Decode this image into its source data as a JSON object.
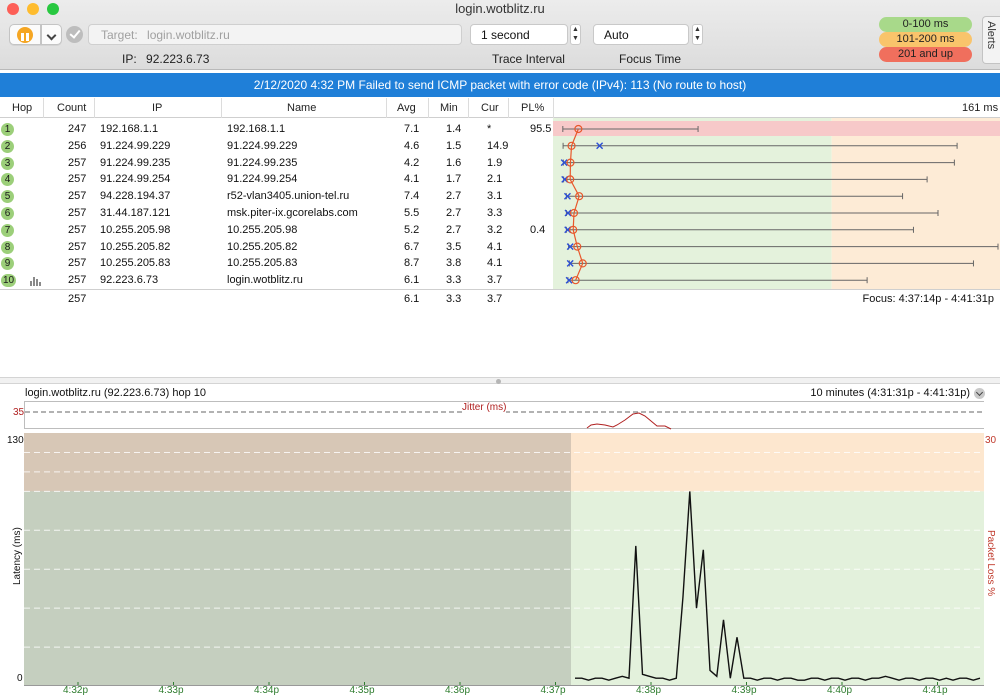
{
  "window": {
    "title": "login.wotblitz.ru"
  },
  "toolbar": {
    "target_label": "Target:",
    "target_value": "login.wotblitz.ru",
    "ip_label": "IP:",
    "ip_value": "92.223.6.73",
    "trace_interval_value": "1 second",
    "trace_interval_label": "Trace Interval",
    "focus_time_value": "Auto",
    "focus_time_label": "Focus Time",
    "alerts_tab": "Alerts",
    "legend": [
      {
        "label": "0-100 ms",
        "color": "#a8d98a"
      },
      {
        "label": "101-200 ms",
        "color": "#f9c46b"
      },
      {
        "label": "201 and up",
        "color": "#f06f5d"
      }
    ]
  },
  "alert_banner": "2/12/2020 4:32 PM Failed to send ICMP packet with error code (IPv4): 113 (No route to host)",
  "table": {
    "columns": [
      "Hop",
      "Count",
      "IP",
      "Name",
      "Avg",
      "Min",
      "Cur",
      "PL%"
    ],
    "graph_max_label": "161 ms",
    "rows": [
      {
        "hop": "1",
        "count": "247",
        "ip": "192.168.1.1",
        "name": "192.168.1.1",
        "avg": "7.1",
        "min": "1.4",
        "cur": "*",
        "pl": "95.5",
        "avg_ms": 7.1,
        "min_ms": 1.4,
        "cur_ms": null,
        "max_ms": 51
      },
      {
        "hop": "2",
        "count": "256",
        "ip": "91.224.99.229",
        "name": "91.224.99.229",
        "avg": "4.6",
        "min": "1.5",
        "cur": "14.9",
        "pl": "",
        "avg_ms": 4.6,
        "min_ms": 1.5,
        "cur_ms": 14.9,
        "max_ms": 146
      },
      {
        "hop": "3",
        "count": "257",
        "ip": "91.224.99.235",
        "name": "91.224.99.235",
        "avg": "4.2",
        "min": "1.6",
        "cur": "1.9",
        "pl": "",
        "avg_ms": 4.2,
        "min_ms": 1.6,
        "cur_ms": 1.9,
        "max_ms": 145
      },
      {
        "hop": "4",
        "count": "257",
        "ip": "91.224.99.254",
        "name": "91.224.99.254",
        "avg": "4.1",
        "min": "1.7",
        "cur": "2.1",
        "pl": "",
        "avg_ms": 4.1,
        "min_ms": 1.7,
        "cur_ms": 2.1,
        "max_ms": 135
      },
      {
        "hop": "5",
        "count": "257",
        "ip": "94.228.194.37",
        "name": "r52-vlan3405.union-tel.ru",
        "avg": "7.4",
        "min": "2.7",
        "cur": "3.1",
        "pl": "",
        "avg_ms": 7.4,
        "min_ms": 2.7,
        "cur_ms": 3.1,
        "max_ms": 126
      },
      {
        "hop": "6",
        "count": "257",
        "ip": "31.44.187.121",
        "name": "msk.piter-ix.gcorelabs.com",
        "avg": "5.5",
        "min": "2.7",
        "cur": "3.3",
        "pl": "",
        "avg_ms": 5.5,
        "min_ms": 2.7,
        "cur_ms": 3.3,
        "max_ms": 139
      },
      {
        "hop": "7",
        "count": "257",
        "ip": "10.255.205.98",
        "name": "10.255.205.98",
        "avg": "5.2",
        "min": "2.7",
        "cur": "3.2",
        "pl": "0.4",
        "avg_ms": 5.2,
        "min_ms": 2.7,
        "cur_ms": 3.2,
        "max_ms": 130
      },
      {
        "hop": "8",
        "count": "257",
        "ip": "10.255.205.82",
        "name": "10.255.205.82",
        "avg": "6.7",
        "min": "3.5",
        "cur": "4.1",
        "pl": "",
        "avg_ms": 6.7,
        "min_ms": 3.5,
        "cur_ms": 4.1,
        "max_ms": 161
      },
      {
        "hop": "9",
        "count": "257",
        "ip": "10.255.205.83",
        "name": "10.255.205.83",
        "avg": "8.7",
        "min": "3.8",
        "cur": "4.1",
        "pl": "",
        "avg_ms": 8.7,
        "min_ms": 3.8,
        "cur_ms": 4.1,
        "max_ms": 152
      },
      {
        "hop": "10",
        "count": "257",
        "ip": "92.223.6.73",
        "name": "login.wotblitz.ru",
        "avg": "6.1",
        "min": "3.3",
        "cur": "3.7",
        "pl": "",
        "avg_ms": 6.1,
        "min_ms": 3.3,
        "cur_ms": 3.7,
        "max_ms": 113
      }
    ],
    "summary": {
      "count": "257",
      "avg": "6.1",
      "min": "3.3",
      "cur": "3.7"
    },
    "focus_range": "Focus: 4:37:14p - 4:41:31p"
  },
  "graph": {
    "title": "login.wotblitz.ru (92.223.6.73) hop 10",
    "range_label": "10 minutes (4:31:31p - 4:41:31p)",
    "jitter_label": "Jitter (ms)",
    "jitter_max": "35",
    "latency_max": "130",
    "latency_min": "0",
    "loss_max": "30",
    "y_left_label": "Latency (ms)",
    "y_right_label": "Packet Loss %",
    "time_ticks": [
      "4:32p",
      "4:33p",
      "4:34p",
      "4:35p",
      "4:36p",
      "4:37p",
      "4:38p",
      "4:39p",
      "4:40p",
      "4:41p"
    ]
  },
  "chart_data": {
    "type": "line",
    "title": "login.wotblitz.ru (92.223.6.73) hop 10",
    "xlabel": "",
    "ylabel": "Latency (ms)",
    "y2label": "Packet Loss %",
    "ylim": [
      0,
      130
    ],
    "y2lim": [
      0,
      30
    ],
    "x_ticks": [
      "4:32p",
      "4:33p",
      "4:34p",
      "4:35p",
      "4:36p",
      "4:37p",
      "4:38p",
      "4:39p",
      "4:40p",
      "4:41p"
    ],
    "series": [
      {
        "name": "",
        "x_start": "4:37:14p",
        "x_end": "4:41:31p",
        "y": [
          4,
          4,
          3,
          4,
          4,
          3,
          4,
          5,
          4,
          72,
          6,
          5,
          4,
          4,
          3,
          4,
          46,
          100,
          40,
          70,
          8,
          5,
          34,
          4,
          25,
          4,
          4,
          3,
          4,
          4,
          3,
          4,
          4,
          3,
          3,
          4,
          4,
          3,
          4,
          4,
          3,
          4,
          4,
          3,
          4,
          4,
          5,
          4,
          3,
          4,
          4,
          3,
          4,
          4,
          3,
          4,
          3,
          4,
          4,
          3,
          4
        ]
      }
    ]
  }
}
